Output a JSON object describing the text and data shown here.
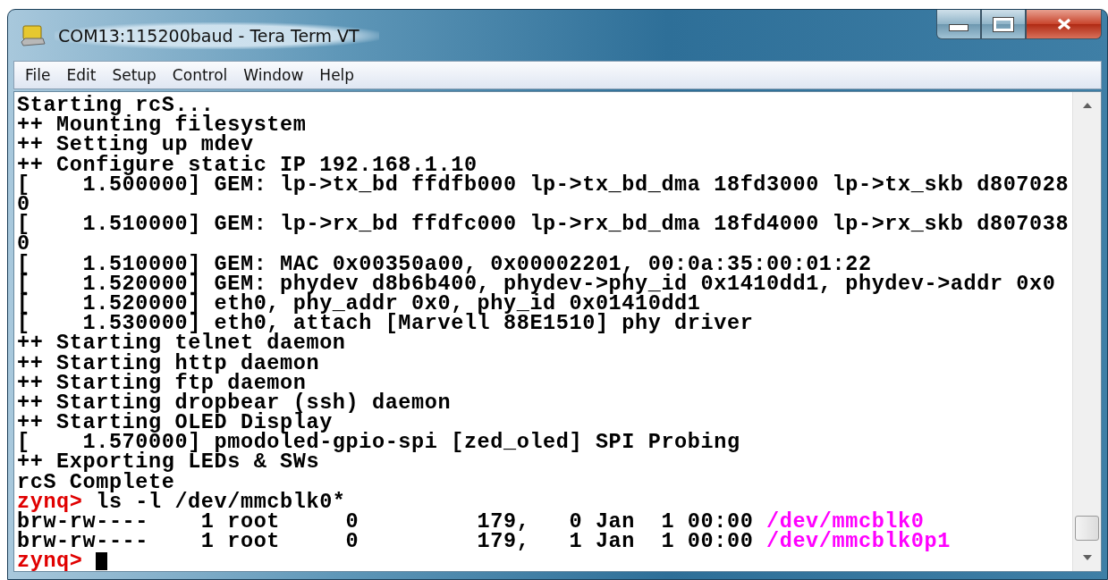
{
  "window": {
    "title": "COM13:115200baud - Tera Term VT"
  },
  "menu": [
    "File",
    "Edit",
    "Setup",
    "Control",
    "Window",
    "Help"
  ],
  "terminal": {
    "lines": [
      {
        "kind": "text",
        "text": "Starting rcS..."
      },
      {
        "kind": "text",
        "text": "++ Mounting filesystem"
      },
      {
        "kind": "text",
        "text": "++ Setting up mdev"
      },
      {
        "kind": "text",
        "text": "++ Configure static IP 192.168.1.10"
      },
      {
        "kind": "text",
        "text": "[    1.500000] GEM: lp->tx_bd ffdfb000 lp->tx_bd_dma 18fd3000 lp->tx_skb d807028"
      },
      {
        "kind": "text",
        "text": "0"
      },
      {
        "kind": "text",
        "text": "[    1.510000] GEM: lp->rx_bd ffdfc000 lp->rx_bd_dma 18fd4000 lp->rx_skb d807038"
      },
      {
        "kind": "text",
        "text": "0"
      },
      {
        "kind": "text",
        "text": "[    1.510000] GEM: MAC 0x00350a00, 0x00002201, 00:0a:35:00:01:22"
      },
      {
        "kind": "text",
        "text": "[    1.520000] GEM: phydev d8b6b400, phydev->phy_id 0x1410dd1, phydev->addr 0x0"
      },
      {
        "kind": "text",
        "text": "[    1.520000] eth0, phy_addr 0x0, phy_id 0x01410dd1"
      },
      {
        "kind": "text",
        "text": "[    1.530000] eth0, attach [Marvell 88E1510] phy driver"
      },
      {
        "kind": "text",
        "text": "++ Starting telnet daemon"
      },
      {
        "kind": "text",
        "text": "++ Starting http daemon"
      },
      {
        "kind": "text",
        "text": "++ Starting ftp daemon"
      },
      {
        "kind": "text",
        "text": "++ Starting dropbear (ssh) daemon"
      },
      {
        "kind": "text",
        "text": "++ Starting OLED Display"
      },
      {
        "kind": "text",
        "text": "[    1.570000] pmodoled-gpio-spi [zed_oled] SPI Probing"
      },
      {
        "kind": "text",
        "text": "++ Exporting LEDs & SWs"
      },
      {
        "kind": "text",
        "text": "rcS Complete"
      },
      {
        "kind": "prompt",
        "prompt": "zynq>",
        "command": "ls -l /dev/mmcblk0*"
      },
      {
        "kind": "listing",
        "text": "brw-rw----    1 root     0         179,   0 Jan  1 00:00",
        "path": "/dev/mmcblk0"
      },
      {
        "kind": "listing",
        "text": "brw-rw----    1 root     0         179,   1 Jan  1 00:00",
        "path": "/dev/mmcblk0p1"
      },
      {
        "kind": "prompt",
        "prompt": "zynq>",
        "cursor": true
      }
    ]
  }
}
